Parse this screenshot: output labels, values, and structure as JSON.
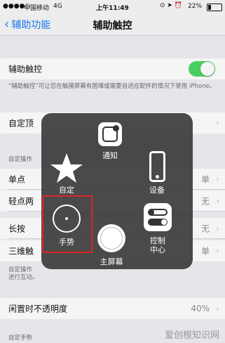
{
  "status": {
    "carrier": "中国移动",
    "network": "4G",
    "time": "上午11:49",
    "battery": "22%"
  },
  "nav": {
    "back": "辅助功能",
    "title": "辅助触控"
  },
  "toggle_row": {
    "label": "辅助触控",
    "on": true
  },
  "note1": "“辅助触控”可让您在触摸屏幕有困难或需要自适应配件的情况下使用 iPhone。",
  "custom_row": {
    "label": "自定顶"
  },
  "section_header": "自定操作",
  "rows": [
    {
      "label": "单点",
      "value": "单"
    },
    {
      "label": "轻点两",
      "value": "无"
    },
    {
      "label": "长按",
      "value": "无"
    },
    {
      "label": "三维触",
      "value": "单"
    }
  ],
  "note2": "自定操作\n进行互动。",
  "idle_row": {
    "label": "闲置时不透明度",
    "value": "40%"
  },
  "section_header2": "自定手势",
  "menu": {
    "items": [
      {
        "label": "通知",
        "icon": "notification-icon"
      },
      {
        "label": "自定",
        "icon": "star-icon"
      },
      {
        "label": "设备",
        "icon": "phone-icon"
      },
      {
        "label": "手势",
        "icon": "gesture-circle-icon"
      },
      {
        "label": "控制\n中心",
        "icon": "control-center-icon"
      },
      {
        "label": "主屏幕",
        "icon": "home-button-icon"
      }
    ]
  },
  "watermark": "爱创根知识网",
  "colors": {
    "accent": "#1d7bf6",
    "toggle_on": "#4cd964",
    "highlight": "#e02424"
  }
}
